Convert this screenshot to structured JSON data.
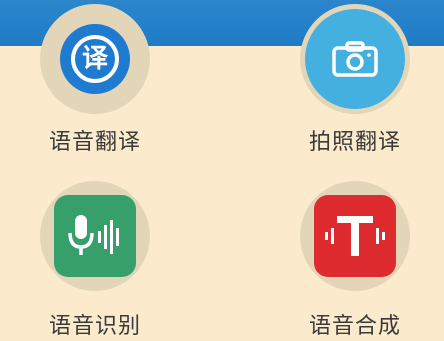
{
  "header": {
    "bar_color": "#1f7bc6"
  },
  "tiles": [
    {
      "label": "语音翻译",
      "icon": "translate-icon",
      "icon_glyph": "译",
      "accent": "#1f7bd0"
    },
    {
      "label": "拍照翻译",
      "icon": "camera-icon",
      "accent": "#43b0df"
    },
    {
      "label": "语音识别",
      "icon": "microphone-wave-icon",
      "accent": "#37a06a"
    },
    {
      "label": "语音合成",
      "icon": "text-to-speech-icon",
      "accent": "#dd2b2f"
    }
  ],
  "colors": {
    "background": "#fbeacc",
    "ring": "#e3d6b8"
  }
}
